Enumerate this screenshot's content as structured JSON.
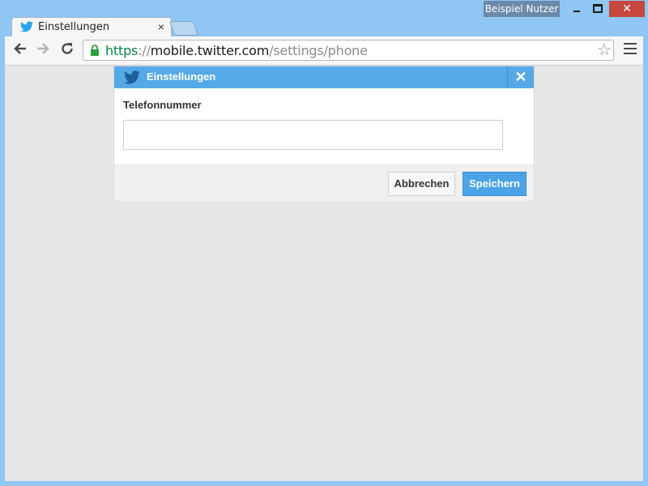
{
  "window": {
    "profile_name": "Beispiel Nutzer"
  },
  "tab": {
    "title": "Einstellungen",
    "close_glyph": "×"
  },
  "toolbar": {
    "url_scheme": "https",
    "url_sep": "://",
    "url_host": "mobile.twitter.com",
    "url_path": "/settings/phone"
  },
  "dialog": {
    "title": "Einstellungen",
    "close_glyph": "✕",
    "field_label": "Telefonnummer",
    "phone_value": "",
    "cancel_label": "Abbrechen",
    "save_label": "Speichern"
  },
  "colors": {
    "brand": "#55a9e6",
    "save_button": "#4ca3e6",
    "window_frame": "#8fc6f4",
    "close_button": "#c7463e",
    "url_scheme": "#0b8043"
  },
  "icons": {
    "tab_favicon": "twitter-bird-icon",
    "lock": "lock-icon",
    "star": "star-icon",
    "menu": "hamburger-menu-icon",
    "back": "back-arrow-icon",
    "forward": "forward-arrow-icon",
    "reload": "reload-icon"
  }
}
